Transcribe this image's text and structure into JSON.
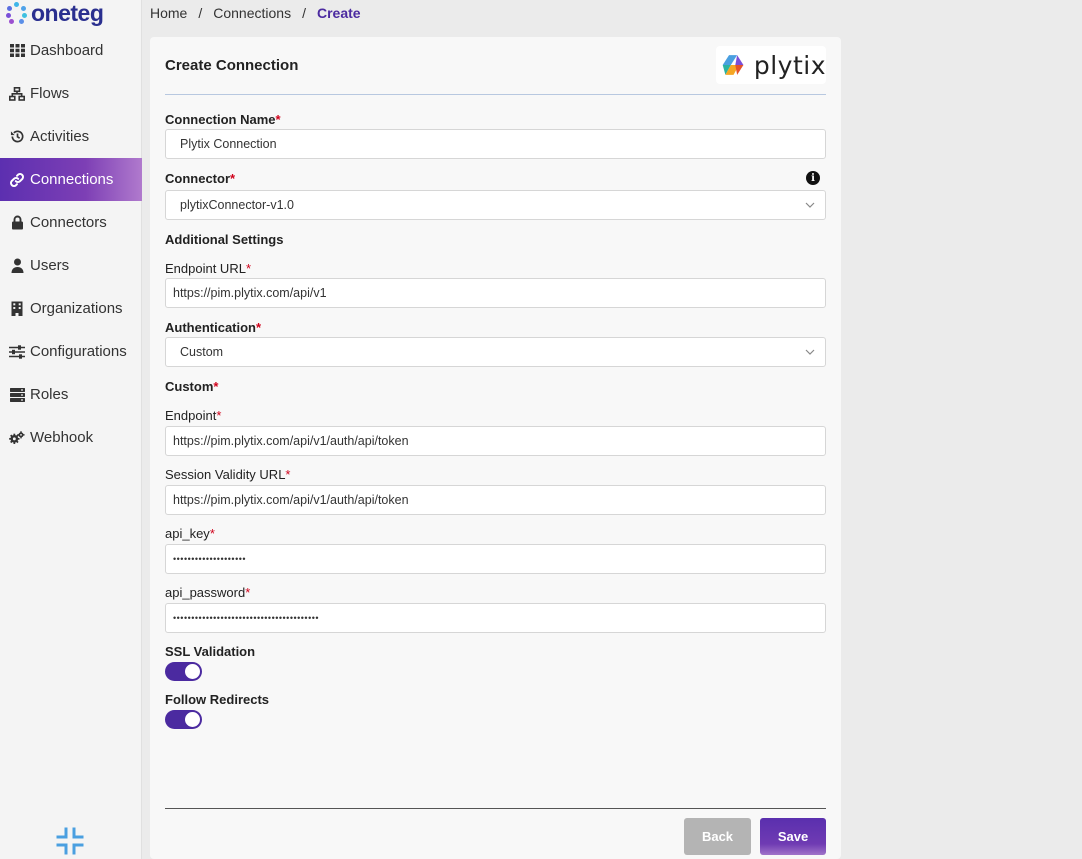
{
  "app": {
    "logo_text": "oneteg"
  },
  "sidebar": {
    "items": [
      {
        "label": "Dashboard",
        "icon": "grid-icon",
        "active": false
      },
      {
        "label": "Flows",
        "icon": "sitemap-icon",
        "active": false
      },
      {
        "label": "Activities",
        "icon": "history-icon",
        "active": false
      },
      {
        "label": "Connections",
        "icon": "link-icon",
        "active": true
      },
      {
        "label": "Connectors",
        "icon": "lock-icon",
        "active": false
      },
      {
        "label": "Users",
        "icon": "user-icon",
        "active": false
      },
      {
        "label": "Organizations",
        "icon": "building-icon",
        "active": false
      },
      {
        "label": "Configurations",
        "icon": "sliders-icon",
        "active": false
      },
      {
        "label": "Roles",
        "icon": "server-icon",
        "active": false
      },
      {
        "label": "Webhook",
        "icon": "gears-icon",
        "active": false
      }
    ],
    "collapse_icon": "compress-icon"
  },
  "breadcrumb": {
    "home": "Home",
    "connections": "Connections",
    "current": "Create",
    "separator": "/"
  },
  "form": {
    "title": "Create Connection",
    "brand_logo_text": "plytix",
    "connection_name": {
      "label": "Connection Name",
      "value": "Plytix Connection"
    },
    "connector": {
      "label": "Connector",
      "value": "plytixConnector-v1.0",
      "info_glyph": "i"
    },
    "additional_settings_label": "Additional Settings",
    "endpoint_url": {
      "label": "Endpoint URL",
      "value": "https://pim.plytix.com/api/v1"
    },
    "authentication": {
      "label": "Authentication",
      "value": "Custom"
    },
    "custom_label": "Custom",
    "endpoint": {
      "label": "Endpoint",
      "value": "https://pim.plytix.com/api/v1/auth/api/token"
    },
    "session_validity_url": {
      "label": "Session Validity URL",
      "value": "https://pim.plytix.com/api/v1/auth/api/token"
    },
    "api_key": {
      "label": "api_key",
      "value": "••••••••••••••••••••"
    },
    "api_password": {
      "label": "api_password",
      "value": "••••••••••••••••••••••••••••••••••••••••"
    },
    "ssl_validation": {
      "label": "SSL Validation",
      "enabled": true
    },
    "follow_redirects": {
      "label": "Follow Redirects",
      "enabled": true
    },
    "required_mark": "*",
    "back_label": "Back",
    "save_label": "Save"
  },
  "colors": {
    "accent": "#4b2aa0",
    "required": "#d0021b",
    "back_button": "#b4b4b4"
  }
}
